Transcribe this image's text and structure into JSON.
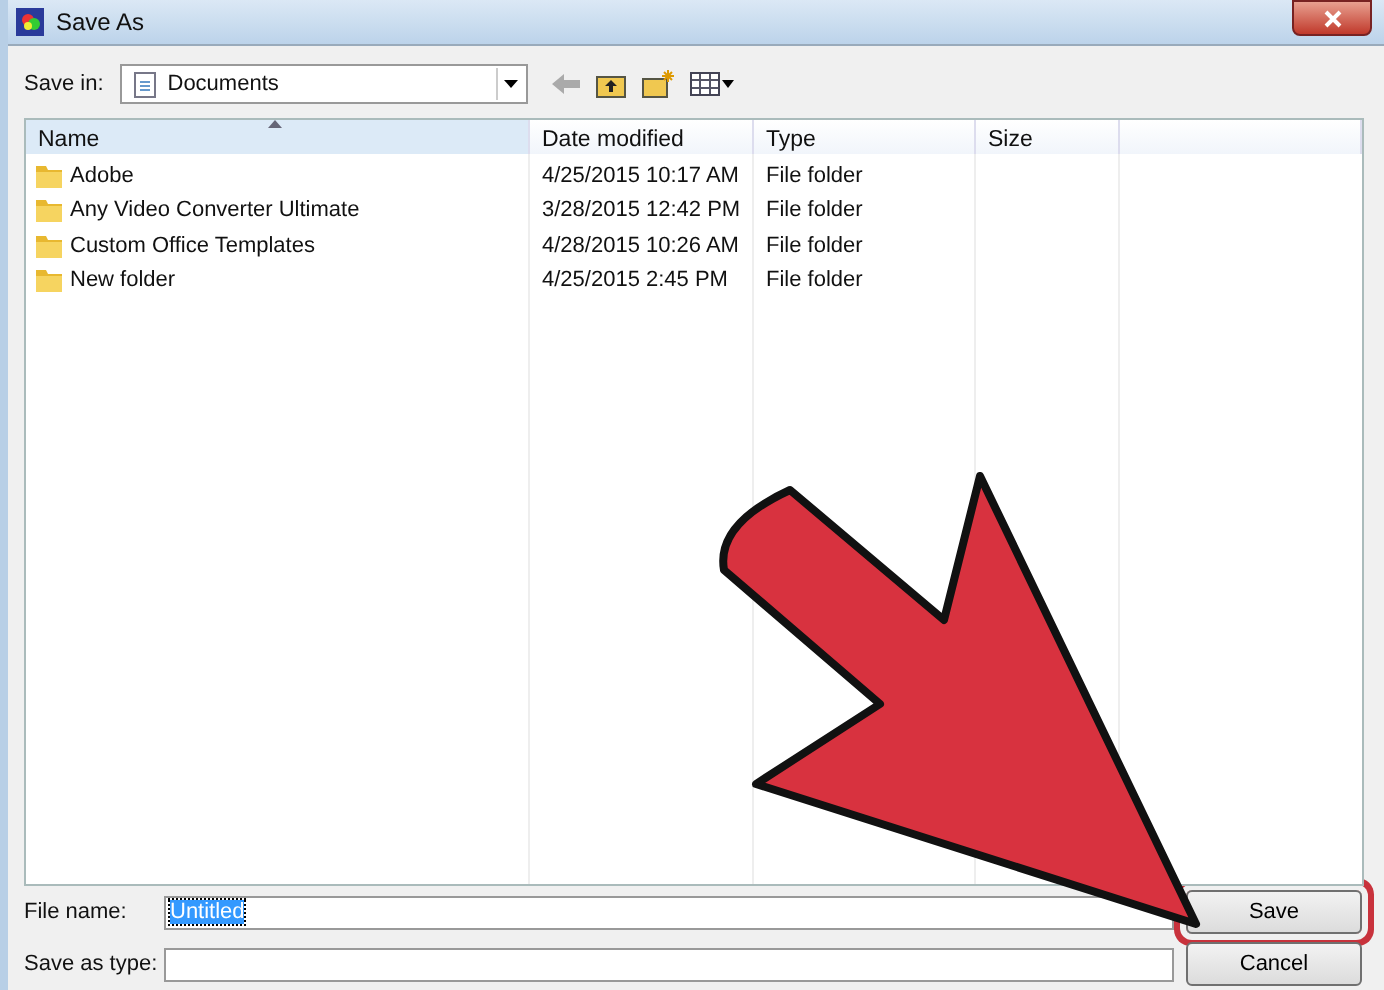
{
  "window": {
    "title": "Save As"
  },
  "save_in": {
    "label": "Save in:",
    "value": "Documents"
  },
  "columns": [
    "Name",
    "Date modified",
    "Type",
    "Size"
  ],
  "rows": [
    {
      "name": "Adobe",
      "date": "4/25/2015 10:17 AM",
      "type": "File folder"
    },
    {
      "name": "Any Video Converter Ultimate",
      "date": "3/28/2015 12:42 PM",
      "type": "File folder"
    },
    {
      "name": "Custom Office Templates",
      "date": "4/28/2015 10:26 AM",
      "type": "File folder"
    },
    {
      "name": "New folder",
      "date": "4/25/2015 2:45 PM",
      "type": "File folder"
    }
  ],
  "file_name": {
    "label": "File name:",
    "value": "Untitled",
    "text_selected": true
  },
  "save_as_type": {
    "label": "Save as type:"
  },
  "buttons": [
    {
      "label": "Save",
      "highlighted": true
    },
    {
      "label": "Cancel",
      "highlighted": false
    }
  ]
}
